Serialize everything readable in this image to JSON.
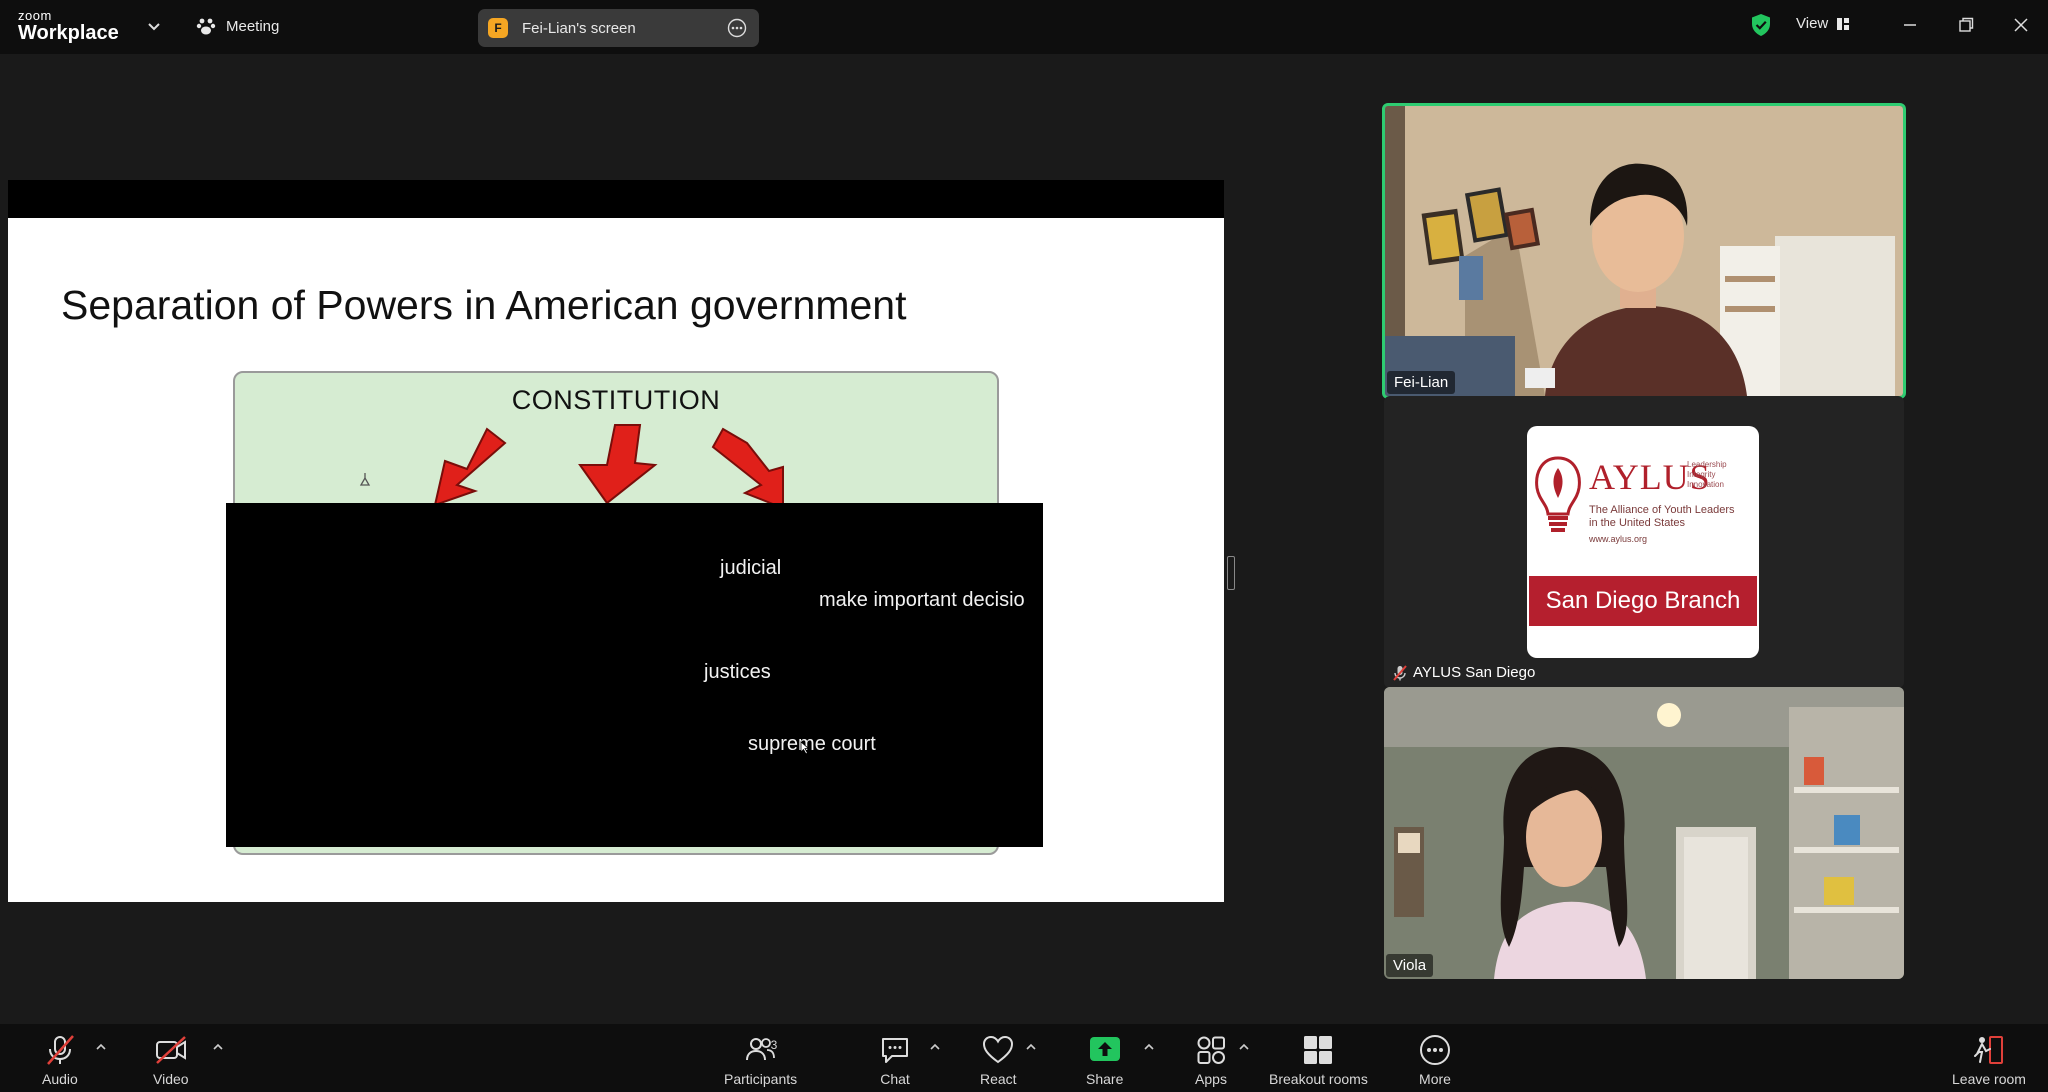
{
  "topbar": {
    "logo_small": "zoom",
    "logo_big": "Workplace",
    "meeting_label": "Meeting",
    "share_pill": {
      "initial": "F",
      "label": "Fei-Lian's screen"
    },
    "view_label": "View"
  },
  "slide": {
    "title": "Separation of Powers in American government",
    "diagram_header": "CONSTITUTION",
    "captions": [
      "judicial",
      "make  important decisio",
      "justices",
      "supreme court"
    ]
  },
  "participants_panel": {
    "tiles": [
      {
        "name": "Fei-Lian",
        "active_speaker": true
      },
      {
        "name": "AYLUS San Diego",
        "muted": true
      },
      {
        "name": "Viola"
      }
    ],
    "aylus_card": {
      "title": "AYLUS",
      "tagline": [
        "Leadership",
        "Integrity",
        "Innovation"
      ],
      "subtitle": [
        "The Alliance of Youth Leaders",
        "in the United States"
      ],
      "url": "www.aylus.org",
      "branch": "San Diego Branch"
    }
  },
  "toolbar": {
    "audio": "Audio",
    "video": "Video",
    "participants": "Participants",
    "participants_count": "3",
    "chat": "Chat",
    "react": "React",
    "share": "Share",
    "apps": "Apps",
    "breakout": "Breakout rooms",
    "more": "More",
    "leave": "Leave room"
  },
  "colors": {
    "active_speaker_border": "#2ecc71",
    "share_green": "#22c55e",
    "muted_red": "#e0403a",
    "aylus_red": "#b51f2e"
  }
}
